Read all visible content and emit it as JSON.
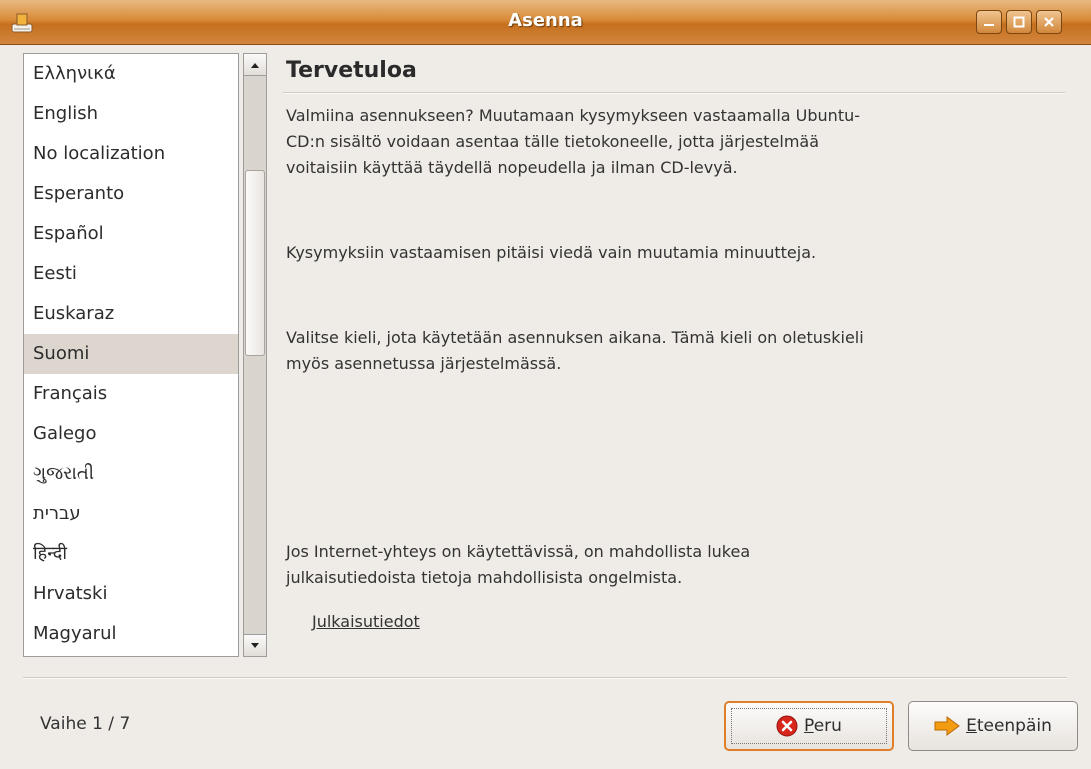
{
  "window": {
    "title": "Asenna"
  },
  "languages": [
    "Ελληνικά",
    "English",
    "No localization",
    "Esperanto",
    "Español",
    "Eesti",
    "Euskaraz",
    "Suomi",
    "Français",
    "Galego",
    "ગુજરાતી",
    "עברית",
    "हिन्दी",
    "Hrvatski",
    "Magyarul"
  ],
  "selected_language": "Suomi",
  "content": {
    "heading": "Tervetuloa",
    "intro": "Valmiina asennukseen? Muutamaan kysymykseen vastaamalla Ubuntu-CD:n sisältö voidaan asentaa tälle tietokoneelle, jotta järjestelmää voitaisiin käyttää täydellä nopeudella ja ilman CD-levyä.",
    "time_note": "Kysymyksiin vastaamisen pitäisi viedä vain muutamia minuutteja.",
    "language_note": "Valitse kieli, jota käytetään asennuksen aikana. Tämä kieli on oletuskieli myös asennetussa järjestelmässä.",
    "internet_note": "Jos Internet-yhteys on käytettävissä, on mahdollista lukea julkaisutiedoista tietoja mahdollisista ongelmista.",
    "release_notes_link": "Julkaisutiedot"
  },
  "footer": {
    "step": "Vaihe 1 / 7",
    "cancel_label": "Peru",
    "forward_label": "Eteenpäin"
  },
  "icons": {
    "cancel": "cancel-icon",
    "forward": "forward-arrow-icon",
    "app": "installer-icon"
  },
  "colors": {
    "titlebar": "#d98b38",
    "selection": "#dcd6cf",
    "focus_border": "#e07f2a",
    "cancel_icon": "#d9261c",
    "forward_icon": "#f39c12"
  }
}
